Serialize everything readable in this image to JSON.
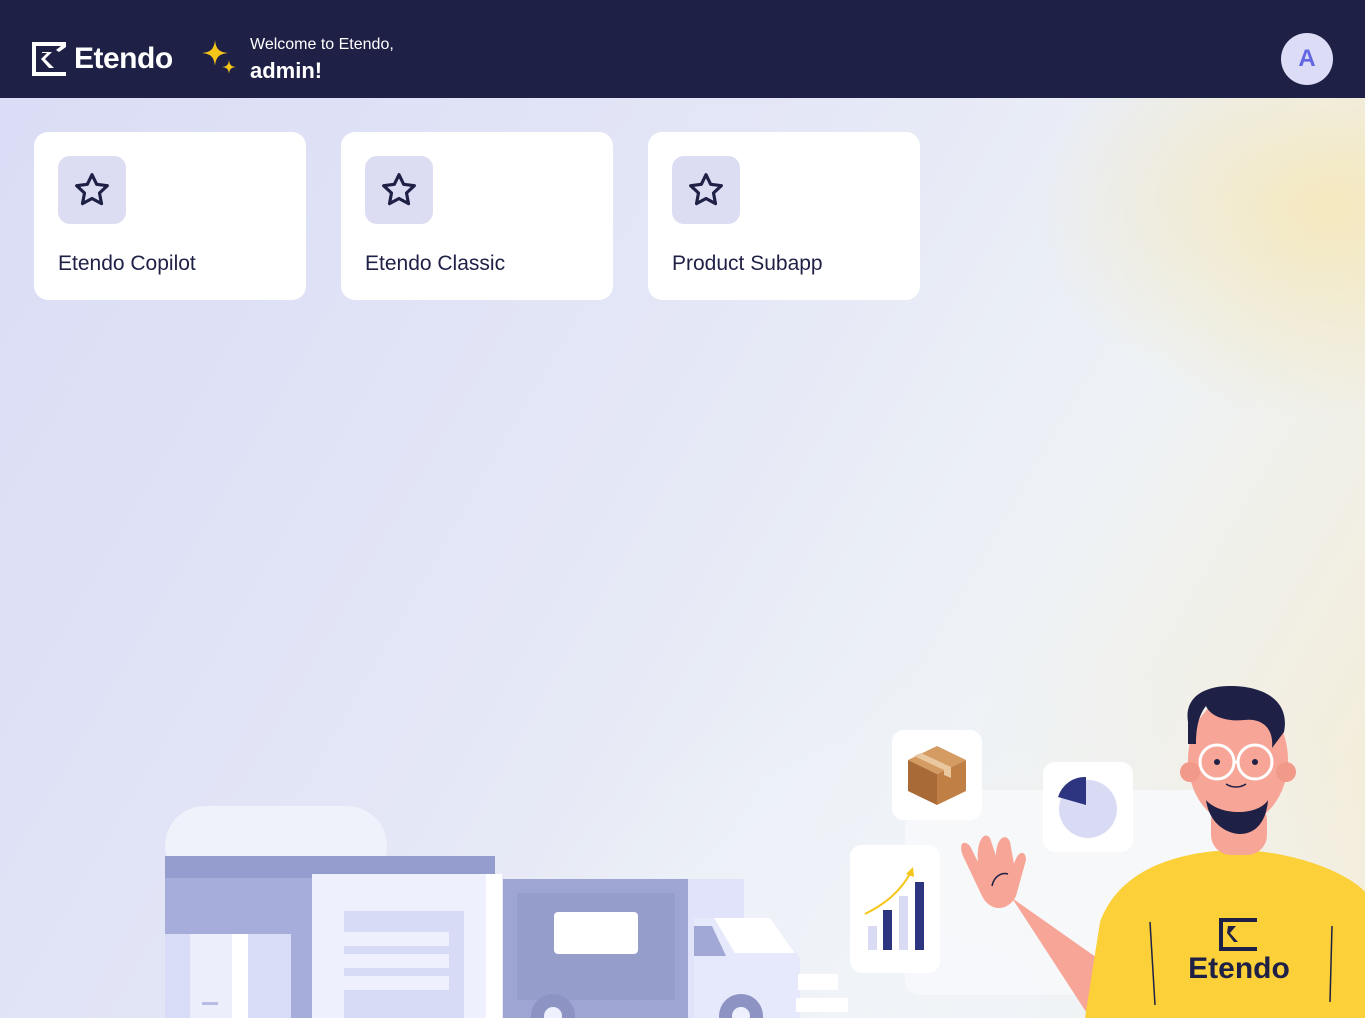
{
  "header": {
    "logo_text": "Etendo",
    "welcome_line": "Welcome to Etendo,",
    "welcome_name": "admin!",
    "avatar_initial": "A"
  },
  "cards": [
    {
      "label": "Etendo Copilot",
      "icon": "star-icon"
    },
    {
      "label": "Etendo Classic",
      "icon": "star-icon"
    },
    {
      "label": "Product Subapp",
      "icon": "star-icon"
    }
  ],
  "illustration": {
    "shirt_logo_text": "Etendo"
  },
  "colors": {
    "header_bg": "#1e2046",
    "card_icon_bg": "#dcdcf3",
    "avatar_bg": "#dcdcf6",
    "avatar_text": "#6366e3",
    "sparkle": "#f5c518",
    "shirt": "#fbd038"
  }
}
